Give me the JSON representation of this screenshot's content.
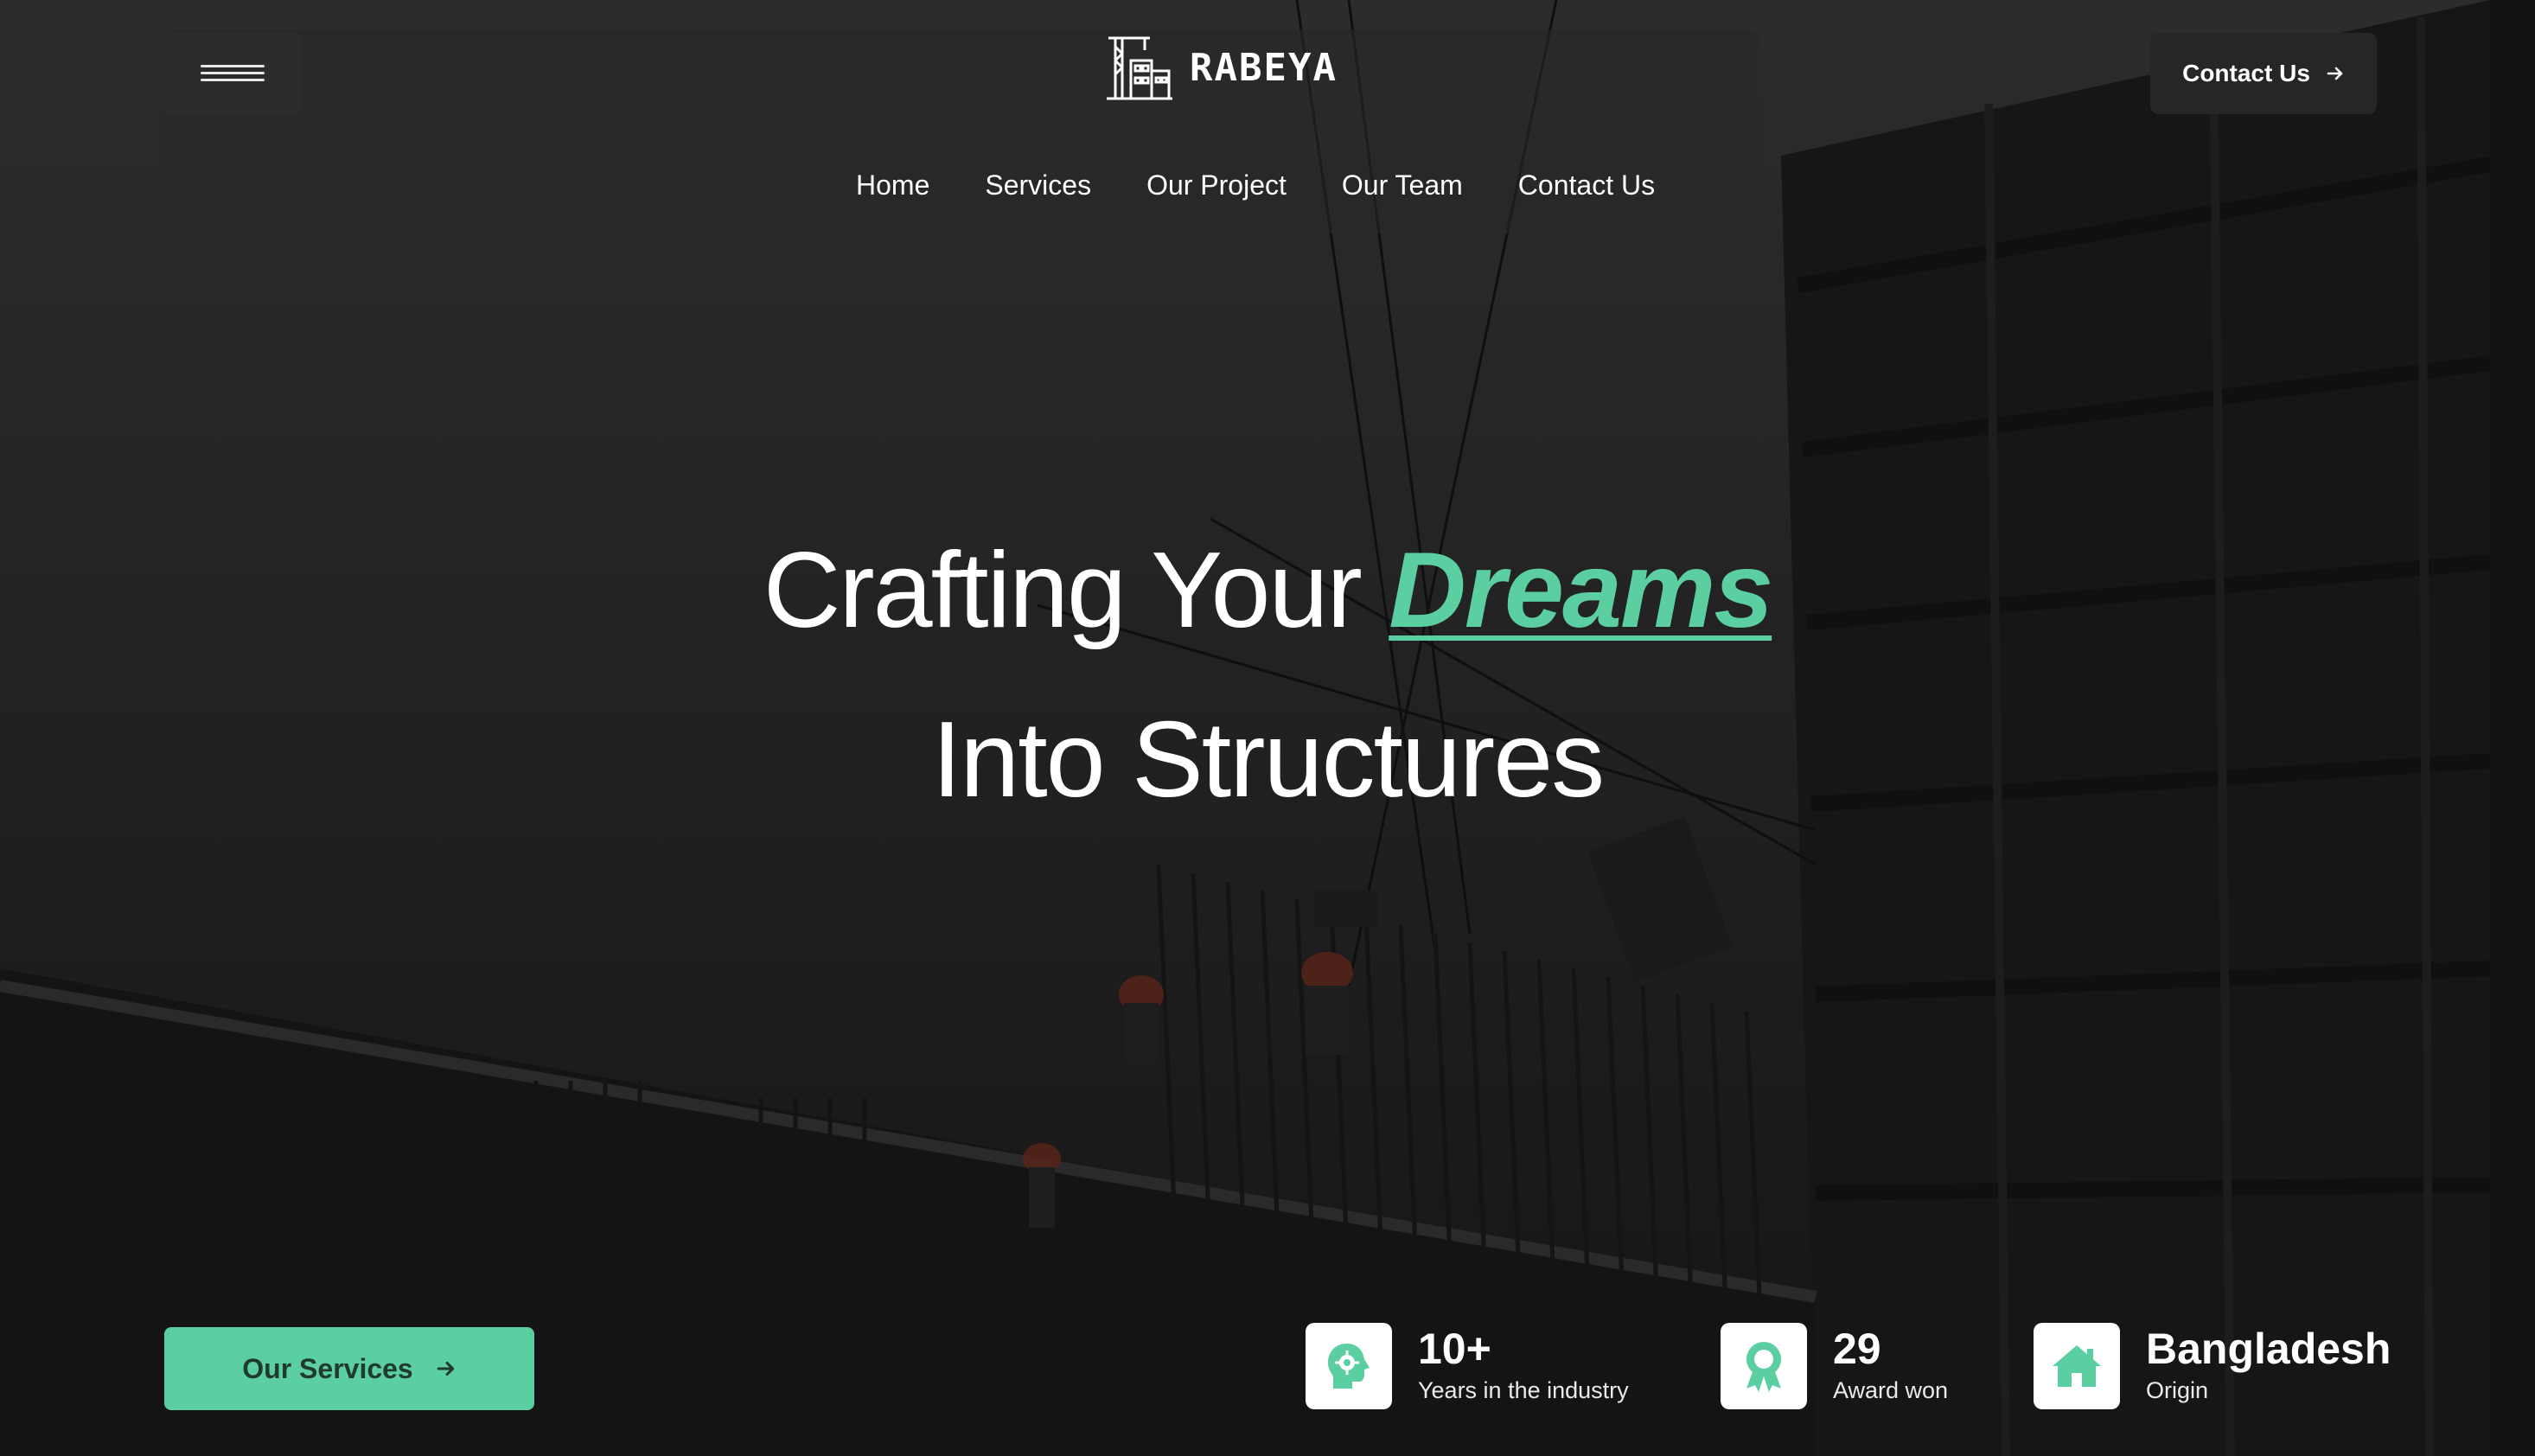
{
  "brand": {
    "name": "RABEYA"
  },
  "header": {
    "menu_icon": "hamburger-icon",
    "contact_label": "Contact Us",
    "contact_icon": "arrow-right-icon"
  },
  "nav": {
    "items": [
      {
        "label": "Home"
      },
      {
        "label": "Services"
      },
      {
        "label": "Our Project"
      },
      {
        "label": "Our Team"
      },
      {
        "label": "Contact Us"
      }
    ]
  },
  "hero": {
    "line1_prefix": "Crafting Your",
    "line1_accent": "Dreams",
    "line2": "Into Structures"
  },
  "cta": {
    "label": "Our Services",
    "icon": "arrow-right-icon"
  },
  "stats": [
    {
      "value": "10+",
      "label": "Years in the industry",
      "icon": "head-gear-icon"
    },
    {
      "value": "29",
      "label": "Award won",
      "icon": "award-ribbon-icon"
    },
    {
      "value": "Bangladesh",
      "label": "Origin",
      "icon": "house-icon"
    }
  ],
  "colors": {
    "accent": "#5ccfa2",
    "button_text": "#1f3a30"
  }
}
